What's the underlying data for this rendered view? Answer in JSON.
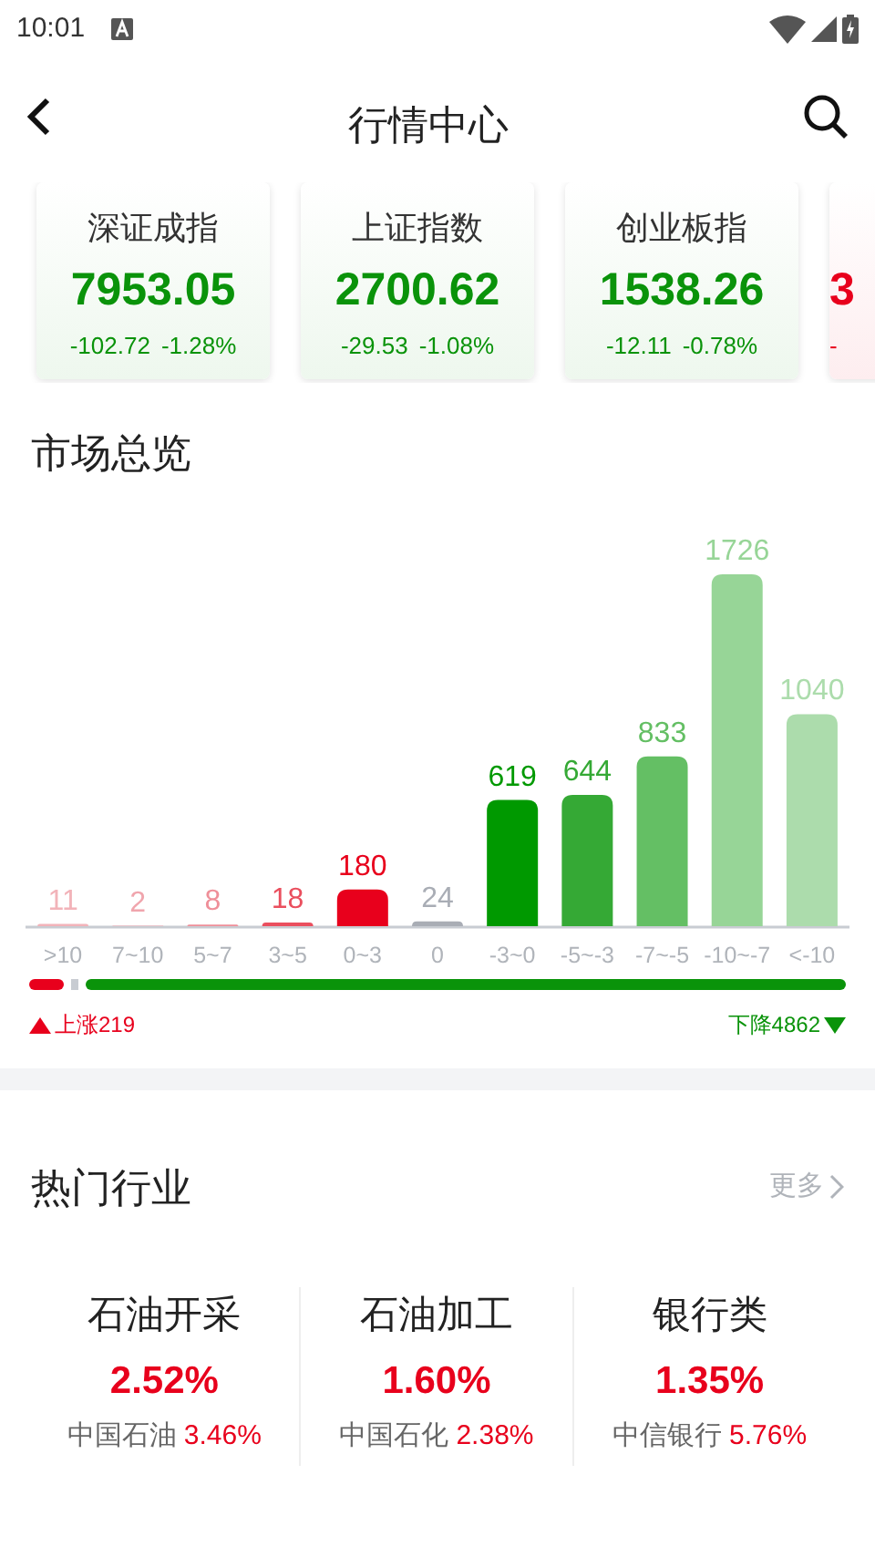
{
  "status_bar": {
    "time": "10:01"
  },
  "header": {
    "title": "行情中心"
  },
  "index_cards": [
    {
      "name": "深证成指",
      "value": "7953.05",
      "change": "-102.72",
      "percent": "-1.28%",
      "color": "#0a930a"
    },
    {
      "name": "上证指数",
      "value": "2700.62",
      "change": "-29.53",
      "percent": "-1.08%",
      "color": "#0a930a"
    },
    {
      "name": "创业板指",
      "value": "1538.26",
      "change": "-12.11",
      "percent": "-0.78%",
      "color": "#0a930a"
    },
    {
      "value": "3",
      "change": "-",
      "color": "#e8001c"
    }
  ],
  "market_overview": {
    "title": "市场总览",
    "chart_data": {
      "type": "bar",
      "categories": [
        ">10",
        "7~10",
        "5~7",
        "3~5",
        "0~3",
        "0",
        "-3~0",
        "-5~-3",
        "-7~-5",
        "-10~-7",
        "<-10"
      ],
      "series": [
        {
          "color": "#f2b3b9",
          "values": [
            11,
            null,
            null,
            null,
            null,
            null,
            null,
            null,
            null,
            null,
            null
          ]
        },
        {
          "color": "#f0a5ad",
          "values": [
            null,
            2,
            null,
            null,
            null,
            null,
            null,
            null,
            null,
            null,
            null
          ]
        },
        {
          "color": "#ef8f99",
          "values": [
            null,
            null,
            8,
            null,
            null,
            null,
            null,
            null,
            null,
            null,
            null
          ]
        },
        {
          "color": "#ea4f5e",
          "values": [
            null,
            null,
            null,
            18,
            null,
            null,
            null,
            null,
            null,
            null,
            null
          ]
        },
        {
          "color": "#e8001c",
          "values": [
            null,
            null,
            null,
            null,
            180,
            null,
            null,
            null,
            null,
            null,
            null
          ]
        },
        {
          "color": "#a9adb5",
          "values": [
            null,
            null,
            null,
            null,
            null,
            24,
            null,
            null,
            null,
            null,
            null
          ]
        },
        {
          "color": "#009900",
          "values": [
            null,
            null,
            null,
            null,
            null,
            null,
            619,
            null,
            null,
            null,
            null
          ]
        },
        {
          "color": "#35a935",
          "values": [
            null,
            null,
            null,
            null,
            null,
            null,
            null,
            644,
            null,
            null,
            null
          ]
        },
        {
          "color": "#64bf64",
          "values": [
            null,
            null,
            null,
            null,
            null,
            null,
            null,
            null,
            833,
            null,
            null
          ]
        },
        {
          "color": "#97d597",
          "values": [
            null,
            null,
            null,
            null,
            null,
            null,
            null,
            null,
            null,
            1726,
            null
          ]
        },
        {
          "color": "#acdcac",
          "values": [
            null,
            null,
            null,
            null,
            null,
            null,
            null,
            null,
            null,
            null,
            1040
          ]
        }
      ],
      "data_labels": true
    },
    "rise_label": "上涨219",
    "fall_label": "下降4862"
  },
  "hot_industries": {
    "title": "热门行业",
    "more": "更多",
    "items": [
      {
        "name": "石油开采",
        "percent": "2.52%",
        "stock": "中国石油",
        "stock_percent": "3.46%"
      },
      {
        "name": "石油加工",
        "percent": "1.60%",
        "stock": "中国石化",
        "stock_percent": "2.38%"
      },
      {
        "name": "银行类",
        "percent": "1.35%",
        "stock": "中信银行",
        "stock_percent": "5.76%"
      }
    ]
  }
}
